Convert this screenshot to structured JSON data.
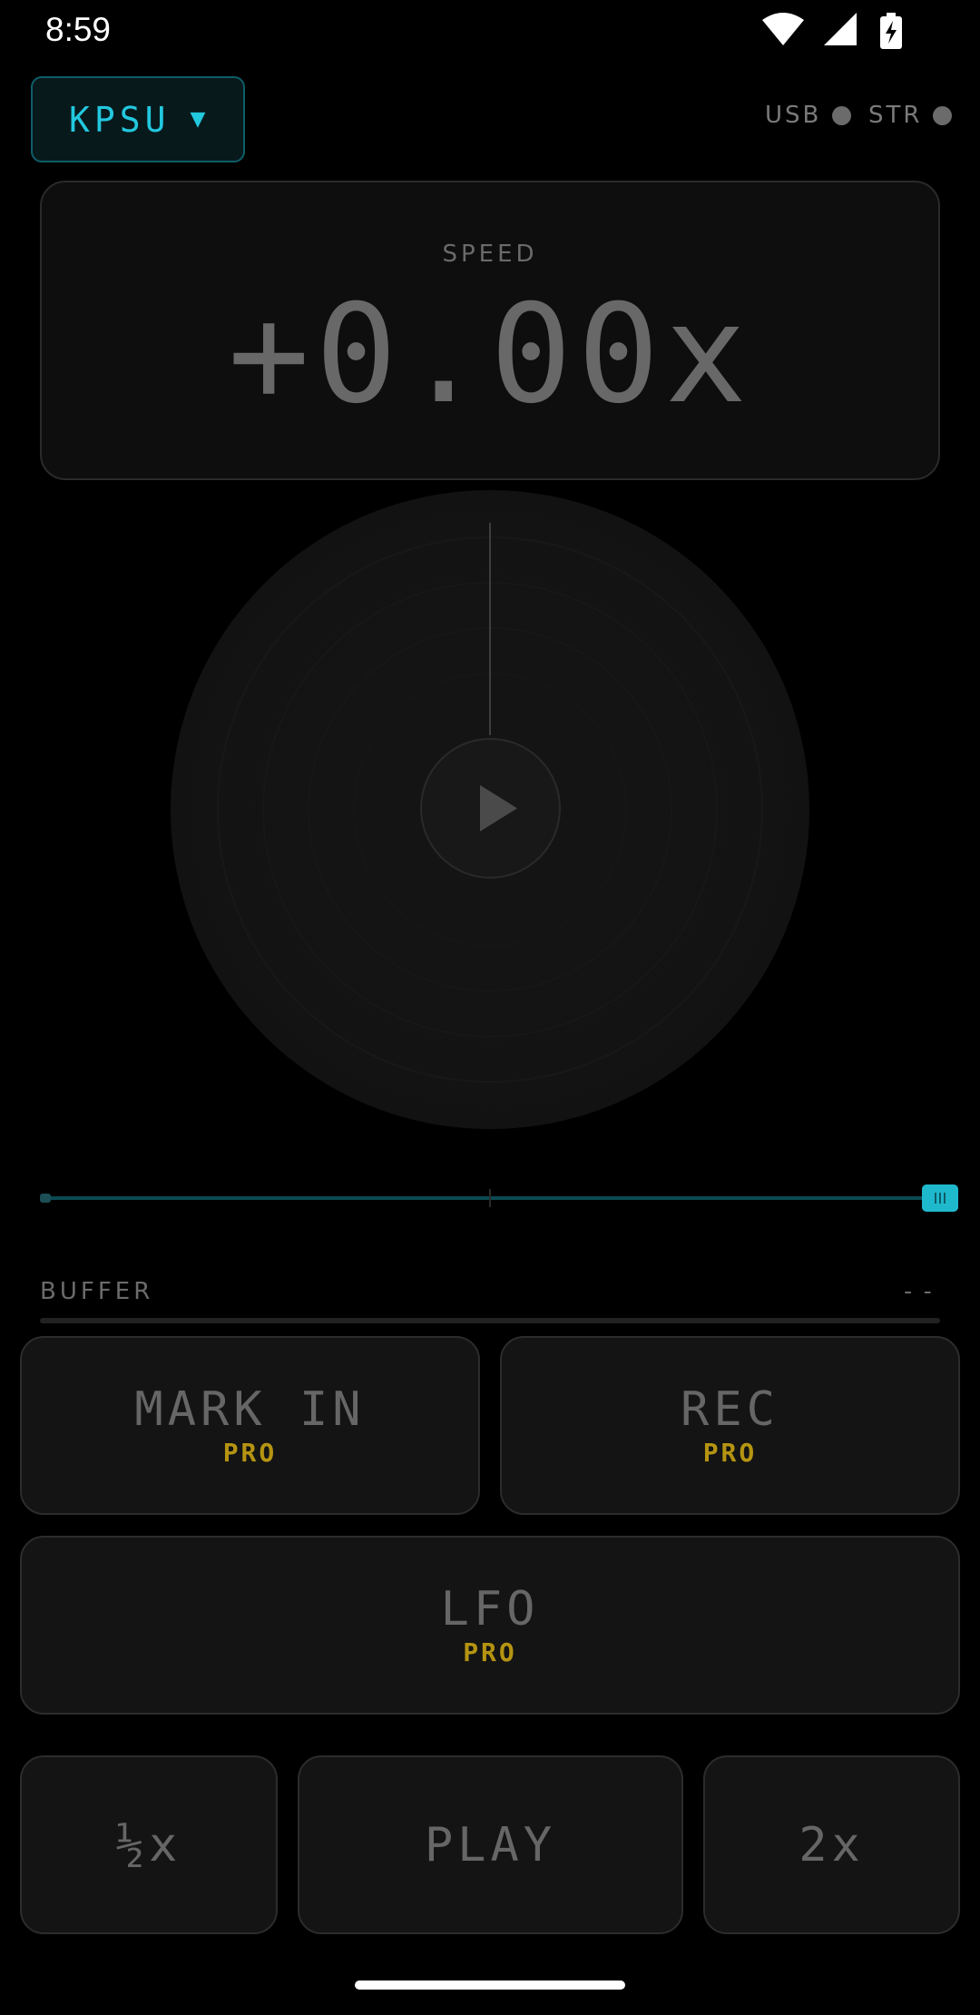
{
  "status_bar": {
    "time": "8:59",
    "icons": [
      "wifi-icon",
      "cell-signal-icon",
      "battery-charging-icon"
    ]
  },
  "header": {
    "station": "KPSU",
    "caret": "▼",
    "indicators": [
      {
        "label": "USB",
        "active": false
      },
      {
        "label": "STR",
        "active": false
      }
    ]
  },
  "speed": {
    "label": "SPEED",
    "value": "+0.00x"
  },
  "platter": {
    "center_icon": "play-icon"
  },
  "buffer": {
    "label": "BUFFER",
    "value": "--"
  },
  "buttons": {
    "mark_in": {
      "label": "MARK IN",
      "badge": "PRO"
    },
    "rec": {
      "label": "REC",
      "badge": "PRO"
    },
    "lfo": {
      "label": "LFO",
      "badge": "PRO"
    },
    "half_speed": {
      "label": "½x"
    },
    "play": {
      "label": "PLAY"
    },
    "double_speed": {
      "label": "2x"
    }
  },
  "colors": {
    "accent": "#22c8de",
    "pro_badge": "#b59412",
    "indicator_off": "#6b6b6b",
    "background": "#000000"
  }
}
